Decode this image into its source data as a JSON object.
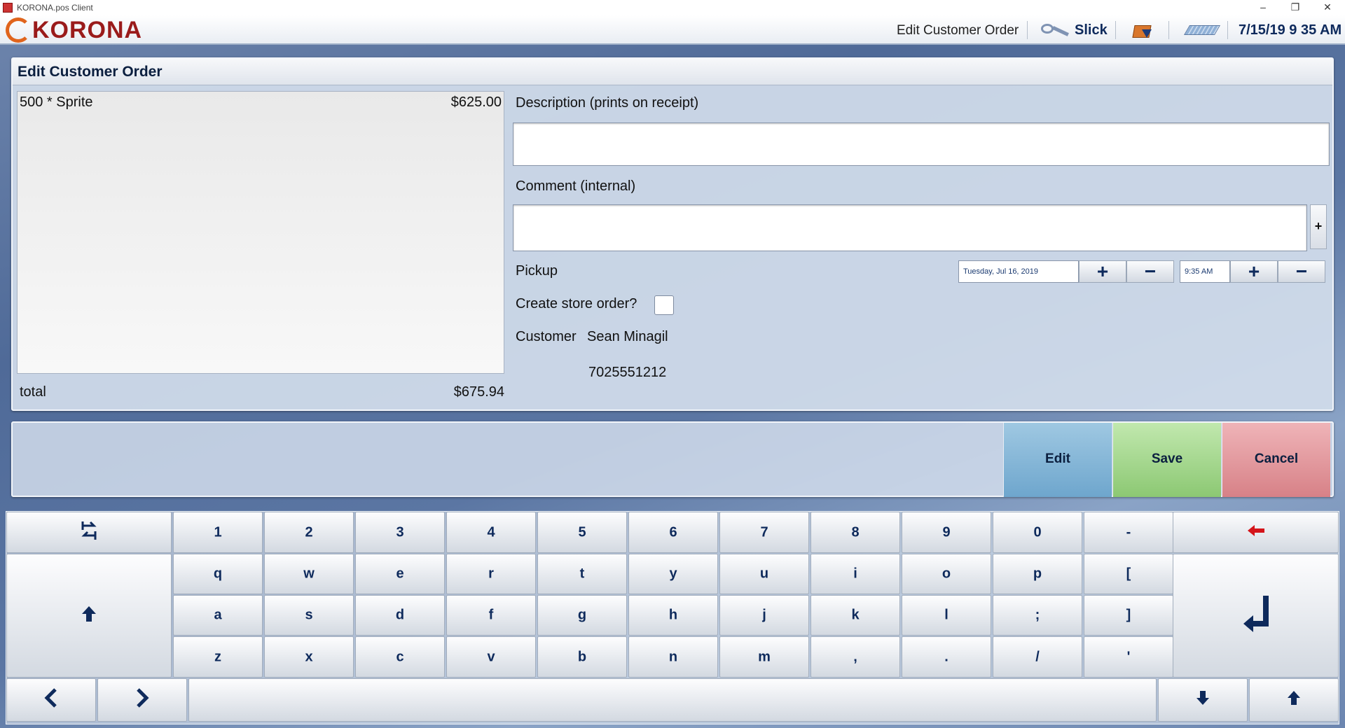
{
  "window": {
    "title": "KORONA.pos Client",
    "controls": [
      "–",
      "❐",
      "✕"
    ]
  },
  "header": {
    "logo_text": "KORONA",
    "screen_title": "Edit Customer Order",
    "user": "Slick",
    "datetime": "7/15/19 9 35 AM",
    "icons": [
      "key-icon",
      "notification-icon",
      "keyboard-icon"
    ]
  },
  "order": {
    "panel_title": "Edit Customer Order",
    "items": [
      {
        "name": "500 * Sprite",
        "price": "$625.00"
      }
    ],
    "total_label": "total",
    "total_value": "$675.94",
    "description_label": "Description (prints on receipt)",
    "description_value": "",
    "comment_label": "Comment (internal)",
    "comment_value": "",
    "comment_add": "+",
    "pickup_label": "Pickup",
    "pickup_date": "Tuesday, Jul 16, 2019",
    "pickup_time": "9:35 AM",
    "plus": "+",
    "minus": "−",
    "store_order_label": "Create store order?",
    "store_order_checked": false,
    "customer_label": "Customer",
    "customer_name": "Sean Minagil",
    "customer_phone": "7025551212"
  },
  "actions": {
    "edit": "Edit",
    "save": "Save",
    "cancel": "Cancel",
    "colors": {
      "edit": "#7fb3d6",
      "save": "#9fd489",
      "cancel": "#e0959a"
    }
  },
  "keyboard": {
    "row1": [
      "1",
      "2",
      "3",
      "4",
      "5",
      "6",
      "7",
      "8",
      "9",
      "0",
      "-"
    ],
    "row2": [
      "q",
      "w",
      "e",
      "r",
      "t",
      "y",
      "u",
      "i",
      "o",
      "p",
      "["
    ],
    "row3": [
      "a",
      "s",
      "d",
      "f",
      "g",
      "h",
      "j",
      "k",
      "l",
      ";",
      "]"
    ],
    "row4": [
      "z",
      "x",
      "c",
      "v",
      "b",
      "n",
      "m",
      ",",
      ".",
      "/",
      "'"
    ],
    "tab_icon": "tab-icon",
    "backspace_icon": "backspace-arrow-icon",
    "shift_icon": "shift-up-arrow-icon",
    "enter_icon": "enter-return-icon",
    "left_icon": "chevron-left-icon",
    "right_icon": "chevron-right-icon",
    "down_icon": "arrow-down-icon",
    "up_icon": "arrow-up-icon"
  }
}
